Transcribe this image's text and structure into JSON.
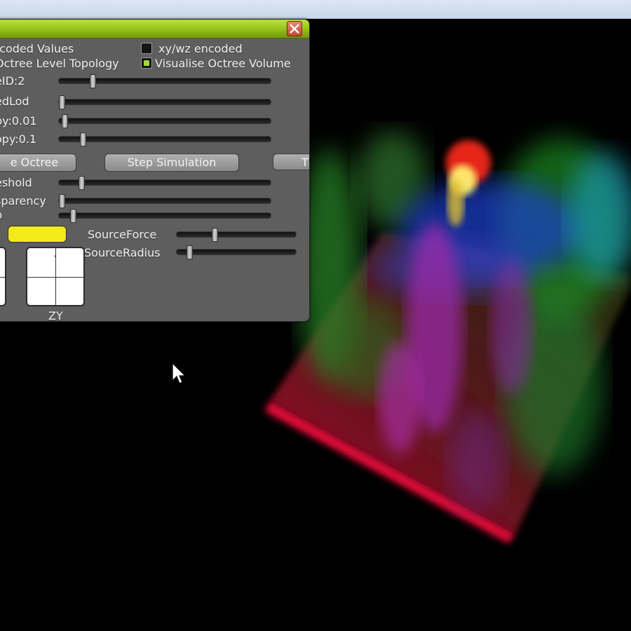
{
  "panel": {
    "checkboxes": [
      {
        "label": "ncoded Values",
        "checked": null
      },
      {
        "label": "Octree Level Topology",
        "checked": null
      },
      {
        "label": "xy/wz encoded",
        "checked": false
      },
      {
        "label": "Visualise Octree Volume",
        "checked": true
      }
    ],
    "sliders": [
      {
        "label": "eID:2",
        "value": 0.16
      },
      {
        "label": "edLod",
        "value": 0.0
      },
      {
        "label": "py:0.01",
        "value": 0.02
      },
      {
        "label": "opy:0.1",
        "value": 0.1
      },
      {
        "label": "eshold",
        "value": 0.1
      },
      {
        "label": "sparency",
        "value": 0.0
      },
      {
        "label": "p",
        "value": 0.07
      }
    ],
    "buttons": {
      "octree": "e Octree",
      "step": "Step Simulation",
      "third": "T"
    },
    "source": {
      "force_label": "SourceForce",
      "force_value": 0.32,
      "radius_label": "SourceRadius",
      "radius_value": 0.1,
      "color": "#f3ea1a"
    },
    "pads": {
      "zy_label": "ZY"
    }
  },
  "colors": {
    "titlebar": "#8fbd16",
    "panel_bg": "#5e5e5e",
    "accent_check": "#a5d63a",
    "close": "#c24a2e"
  }
}
